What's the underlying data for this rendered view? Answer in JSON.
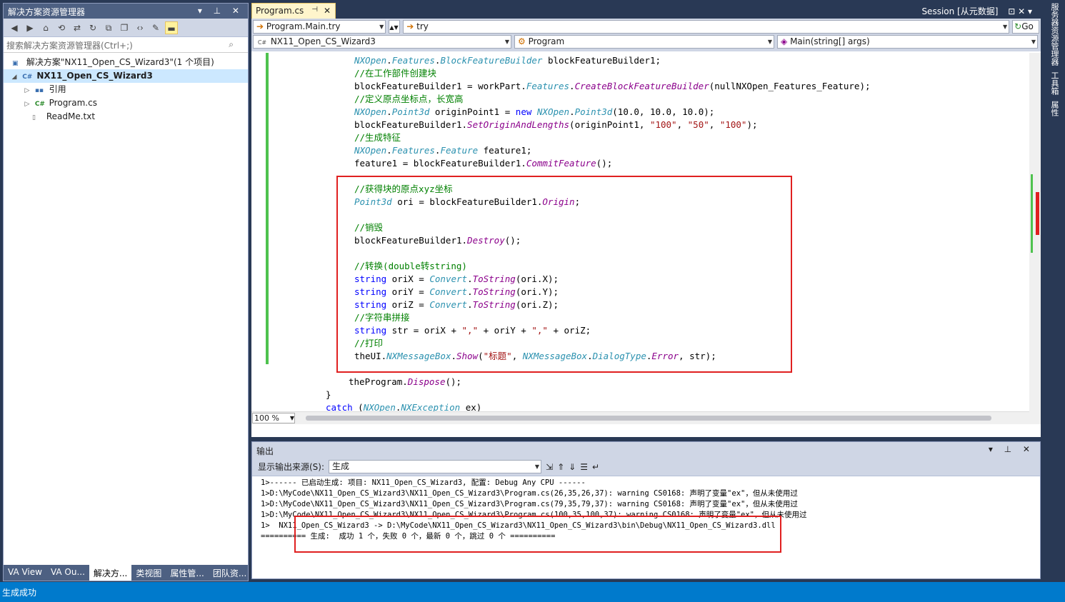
{
  "solution_explorer": {
    "title": "解决方案资源管理器",
    "title_controls": "▾ ⊥ ✕",
    "search_placeholder": "搜索解决方案资源管理器(Ctrl+;)",
    "tree": [
      {
        "label": "解决方案\"NX11_Open_CS_Wizard3\"(1 个项目)",
        "icon": "solution-icon"
      },
      {
        "label": "NX11_Open_CS_Wizard3",
        "icon": "csharp-project-icon",
        "selected": true
      },
      {
        "label": "引用",
        "icon": "references-icon"
      },
      {
        "label": "Program.cs",
        "icon": "csharp-file-icon"
      },
      {
        "label": "ReadMe.txt",
        "icon": "text-file-icon"
      }
    ],
    "bottom_tabs": [
      "VA View",
      "VA Ou...",
      "解决方...",
      "类视图",
      "属性管...",
      "团队资..."
    ]
  },
  "editor": {
    "tab_label": "Program.cs",
    "session_label": "Session [从元数据]",
    "nav": {
      "member": "Program.Main.try",
      "scope": "try",
      "go_label": "Go",
      "project": "NX11_Open_CS_Wizard3",
      "class": "Program",
      "method": "Main(string[] args)"
    },
    "zoom": "100 %",
    "code_lines": [
      "NXOpen.Features.BlockFeatureBuilder blockFeatureBuilder1;",
      "//在工作部件创建块",
      "blockFeatureBuilder1 = workPart.Features.CreateBlockFeatureBuilder(nullNXOpen_Features_Feature);",
      "//定义原点坐标点，长宽高",
      "NXOpen.Point3d originPoint1 = new NXOpen.Point3d(10.0, 10.0, 10.0);",
      "blockFeatureBuilder1.SetOriginAndLengths(originPoint1, \"100\", \"50\", \"100\");",
      "//生成特征",
      "NXOpen.Features.Feature feature1;",
      "feature1 = blockFeatureBuilder1.CommitFeature();",
      "",
      "//获得块的原点xyz坐标",
      "Point3d ori = blockFeatureBuilder1.Origin;",
      "",
      "//销毁",
      "blockFeatureBuilder1.Destroy();",
      "",
      "//转换(double转string)",
      "string oriX = Convert.ToString(ori.X);",
      "string oriY = Convert.ToString(ori.Y);",
      "string oriZ = Convert.ToString(ori.Z);",
      "//字符串拼接",
      "string str = oriX + \",\" + oriY + \",\" + oriZ;",
      "//打印",
      "theUI.NXMessageBox.Show(\"标题\", NXMessageBox.DialogType.Error, str);",
      "",
      "theProgram.Dispose();",
      "}",
      "catch (NXOpen.NXException ex)",
      "{"
    ]
  },
  "output": {
    "title": "输出",
    "source_label": "显示输出来源(S):",
    "source_value": "生成",
    "lines": [
      "1>------ 已启动生成: 项目: NX11_Open_CS_Wizard3, 配置: Debug Any CPU ------",
      "1>D:\\MyCode\\NX11_Open_CS_Wizard3\\NX11_Open_CS_Wizard3\\Program.cs(26,35,26,37): warning CS0168: 声明了变量\"ex\"，但从未使用过",
      "1>D:\\MyCode\\NX11_Open_CS_Wizard3\\NX11_Open_CS_Wizard3\\Program.cs(79,35,79,37): warning CS0168: 声明了变量\"ex\"，但从未使用过",
      "1>D:\\MyCode\\NX11_Open_CS_Wizard3\\NX11_Open_CS_Wizard3\\Program.cs(100,35,100,37): warning CS0168: 声明了变量\"ex\"，但从未使用过",
      "1>  NX11_Open_CS_Wizard3 -> D:\\MyCode\\NX11_Open_CS_Wizard3\\NX11_Open_CS_Wizard3\\bin\\Debug\\NX11_Open_CS_Wizard3.dll",
      "========== 生成:  成功 1 个，失败 0 个，最新 0 个，跳过 0 个 =========="
    ]
  },
  "status_text": "生成成功",
  "right_panel": [
    "服务器资源管理器",
    "工具箱",
    "属性"
  ]
}
